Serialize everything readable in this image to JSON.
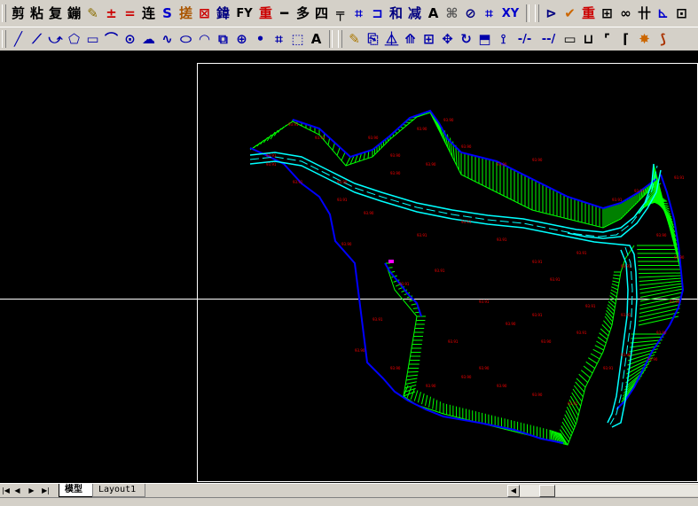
{
  "toolbar_modify": {
    "buttons": [
      {
        "label": "剪",
        "icon": "trim-icon",
        "color": "#000000"
      },
      {
        "label": "粘",
        "icon": "paste-icon",
        "color": "#000000"
      },
      {
        "label": "复",
        "icon": "copy-icon",
        "color": "#000000"
      },
      {
        "label": "鏰",
        "icon": "edit-icon",
        "color": "#000000"
      },
      {
        "label": "✎",
        "icon": "pencil-icon",
        "color": "#8a6d00"
      },
      {
        "label": "±",
        "icon": "extend-icon",
        "color": "#cc0000"
      },
      {
        "label": "=",
        "icon": "offset-icon",
        "color": "#cc0000"
      },
      {
        "label": "连",
        "icon": "join-icon",
        "color": "#000000"
      },
      {
        "label": "S",
        "icon": "stretch-icon",
        "color": "#0000cc"
      },
      {
        "label": "搓",
        "icon": "break-icon",
        "color": "#aa5500"
      },
      {
        "label": "⊠",
        "icon": "erase-icon",
        "color": "#cc0000"
      },
      {
        "label": "鍏",
        "icon": "mirror-icon",
        "color": "#000080"
      },
      {
        "label": "FY",
        "icon": "fillet-icon",
        "color": "#000000"
      },
      {
        "label": "重",
        "icon": "redraw-icon",
        "color": "#cc0000"
      },
      {
        "label": "━",
        "icon": "line-break-icon",
        "color": "#000000"
      },
      {
        "label": "多",
        "icon": "polyline-icon",
        "color": "#000000"
      },
      {
        "label": "四",
        "icon": "rectangle-edit-icon",
        "color": "#000000"
      },
      {
        "label": "╤",
        "icon": "divide-icon",
        "color": "#000000"
      },
      {
        "label": "⌗",
        "icon": "hatch-icon",
        "color": "#0000cc"
      },
      {
        "label": "⊐",
        "icon": "bracket-icon",
        "color": "#0000cc"
      },
      {
        "label": "和",
        "icon": "union-icon",
        "color": "#000080"
      },
      {
        "label": "减",
        "icon": "subtract-icon",
        "color": "#000080"
      },
      {
        "label": "A",
        "icon": "text-icon",
        "color": "#000000"
      },
      {
        "label": "⌘",
        "icon": "text-edit-icon",
        "color": "#555555"
      },
      {
        "label": "⊘",
        "icon": "attribute-icon",
        "color": "#000080"
      },
      {
        "label": "⌗",
        "icon": "grid-icon",
        "color": "#0000cc"
      },
      {
        "label": "XY",
        "icon": "coordinate-icon",
        "color": "#0000cc"
      }
    ],
    "buttons_right": [
      {
        "label": "⊳",
        "icon": "pointer-icon",
        "color": "#000080"
      },
      {
        "label": "✔",
        "icon": "check-icon",
        "color": "#cc6600"
      },
      {
        "label": "重",
        "icon": "regen-icon",
        "color": "#cc0000"
      },
      {
        "label": "⊞",
        "icon": "insert-block-icon",
        "color": "#000000"
      },
      {
        "label": "∞",
        "icon": "link-icon",
        "color": "#000000"
      },
      {
        "label": "卄",
        "icon": "measure-icon",
        "color": "#000000"
      },
      {
        "label": "⊾",
        "icon": "angle-icon",
        "color": "#0000cc"
      },
      {
        "label": "⊡",
        "icon": "zoom-window-icon",
        "color": "#000000"
      }
    ]
  },
  "toolbar_draw": {
    "buttons": [
      {
        "label": "╱",
        "icon": "line-icon",
        "color": "#0000aa"
      },
      {
        "label": "⟋",
        "icon": "construction-line-icon",
        "color": "#0000aa"
      },
      {
        "label": "⤻",
        "icon": "polyline-draw-icon",
        "color": "#0000aa"
      },
      {
        "label": "⬠",
        "icon": "polygon-icon",
        "color": "#0000aa"
      },
      {
        "label": "▭",
        "icon": "rectangle-icon",
        "color": "#0000aa"
      },
      {
        "label": "⌒",
        "icon": "arc-icon",
        "color": "#0000aa"
      },
      {
        "label": "⊙",
        "icon": "circle-icon",
        "color": "#0000aa"
      },
      {
        "label": "☁",
        "icon": "revision-cloud-icon",
        "color": "#0000aa"
      },
      {
        "label": "∿",
        "icon": "spline-icon",
        "color": "#0000aa"
      },
      {
        "label": "⬭",
        "icon": "ellipse-icon",
        "color": "#0000aa"
      },
      {
        "label": "◠",
        "icon": "ellipse-arc-icon",
        "color": "#0000aa"
      },
      {
        "label": "⧉",
        "icon": "insert-icon",
        "color": "#0000aa"
      },
      {
        "label": "⊕",
        "icon": "make-block-icon",
        "color": "#0000aa"
      },
      {
        "label": "•",
        "icon": "point-icon",
        "color": "#0000aa"
      },
      {
        "label": "⌗",
        "icon": "hatch-draw-icon",
        "color": "#0000aa"
      },
      {
        "label": "⬚",
        "icon": "region-icon",
        "color": "#0000aa"
      },
      {
        "label": "A",
        "icon": "mtext-icon",
        "color": "#000000"
      }
    ],
    "buttons_right": [
      {
        "label": "✎",
        "icon": "erase-draw-icon",
        "color": "#aa7700"
      },
      {
        "label": "⎘",
        "icon": "copy-object-icon",
        "color": "#0000aa"
      },
      {
        "label": "⏅",
        "icon": "mirror-draw-icon",
        "color": "#0000aa"
      },
      {
        "label": "⟰",
        "icon": "offset-draw-icon",
        "color": "#0000aa"
      },
      {
        "label": "⊞",
        "icon": "array-icon",
        "color": "#0000aa"
      },
      {
        "label": "✥",
        "icon": "move-icon",
        "color": "#0000aa"
      },
      {
        "label": "↻",
        "icon": "rotate-icon",
        "color": "#0000aa"
      },
      {
        "label": "⬒",
        "icon": "scale-icon",
        "color": "#0000aa"
      },
      {
        "label": "⟟",
        "icon": "stretch-draw-icon",
        "color": "#0000aa"
      },
      {
        "label": "-/-",
        "icon": "trim-draw-icon",
        "color": "#0000aa"
      },
      {
        "label": "--/",
        "icon": "extend-draw-icon",
        "color": "#0000aa"
      },
      {
        "label": "▭",
        "icon": "break-draw-icon",
        "color": "#000000"
      },
      {
        "label": "⊔",
        "icon": "break-at-point-icon",
        "color": "#000000"
      },
      {
        "label": "⌜",
        "icon": "chamfer-icon",
        "color": "#000000"
      },
      {
        "label": "⌈",
        "icon": "fillet-draw-icon",
        "color": "#000000"
      },
      {
        "label": "✸",
        "icon": "explode-icon",
        "color": "#cc6600"
      },
      {
        "label": "⟆",
        "icon": "properties-icon",
        "color": "#aa3300"
      }
    ]
  },
  "canvas": {
    "background": "#000000",
    "colors": {
      "boundary": "#0000ff",
      "slope": "#00ff00",
      "road": "#00ffff",
      "road_center": "#00ffff",
      "elevation": "#ff0000",
      "frame": "#ffffff",
      "highlight": "#ff00ff"
    },
    "elevation_labels": [
      "93.91",
      "93.91",
      "93.91",
      "93.90",
      "93.90",
      "93.90",
      "93.90",
      "93.90",
      "93.90",
      "93.91",
      "93.91",
      "93.91"
    ]
  },
  "bottom": {
    "nav_first": "|◀",
    "nav_prev": "◀",
    "nav_next": "▶",
    "nav_last": "▶|",
    "tab_model": "模型",
    "tab_layout1": "Layout1",
    "scroll_left": "◀"
  }
}
